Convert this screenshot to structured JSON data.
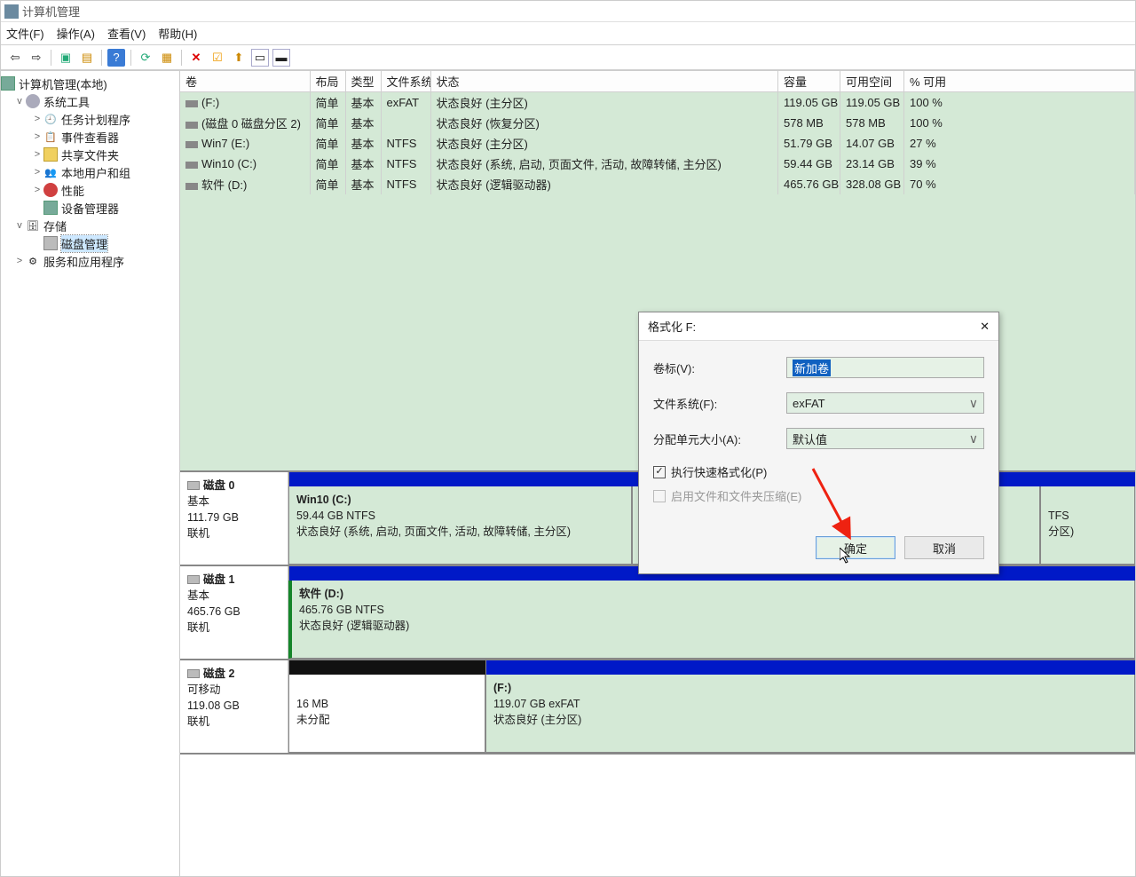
{
  "app": {
    "title": "计算机管理"
  },
  "menu": {
    "file": "文件(F)",
    "action": "操作(A)",
    "view": "查看(V)",
    "help": "帮助(H)"
  },
  "sidebar": {
    "root": "计算机管理(本地)",
    "sys_tools": "系统工具",
    "task_sched": "任务计划程序",
    "event_viewer": "事件查看器",
    "shared": "共享文件夹",
    "local_users": "本地用户和组",
    "perf": "性能",
    "dev_mgr": "设备管理器",
    "storage": "存储",
    "disk_mgmt": "磁盘管理",
    "services": "服务和应用程序"
  },
  "vol_headers": {
    "vol": "卷",
    "layout": "布局",
    "type": "类型",
    "fs": "文件系统",
    "status": "状态",
    "capacity": "容量",
    "free": "可用空间",
    "pct": "% 可用"
  },
  "volumes": [
    {
      "vol": "(F:)",
      "layout": "简单",
      "type": "基本",
      "fs": "exFAT",
      "status": "状态良好 (主分区)",
      "capacity": "119.05 GB",
      "free": "119.05 GB",
      "pct": "100 %"
    },
    {
      "vol": "(磁盘 0 磁盘分区 2)",
      "layout": "简单",
      "type": "基本",
      "fs": "",
      "status": "状态良好 (恢复分区)",
      "capacity": "578 MB",
      "free": "578 MB",
      "pct": "100 %"
    },
    {
      "vol": "Win7 (E:)",
      "layout": "简单",
      "type": "基本",
      "fs": "NTFS",
      "status": "状态良好 (主分区)",
      "capacity": "51.79 GB",
      "free": "14.07 GB",
      "pct": "27 %"
    },
    {
      "vol": "Win10 (C:)",
      "layout": "简单",
      "type": "基本",
      "fs": "NTFS",
      "status": "状态良好 (系统, 启动, 页面文件, 活动, 故障转储, 主分区)",
      "capacity": "59.44 GB",
      "free": "23.14 GB",
      "pct": "39 %"
    },
    {
      "vol": "软件 (D:)",
      "layout": "简单",
      "type": "基本",
      "fs": "NTFS",
      "status": "状态良好 (逻辑驱动器)",
      "capacity": "465.76 GB",
      "free": "328.08 GB",
      "pct": "70 %"
    }
  ],
  "disks": {
    "d0": {
      "hdr": "磁盘 0",
      "type": "基本",
      "size": "111.79 GB",
      "state": "联机",
      "p0": {
        "name": "Win10  (C:)",
        "detail": "59.44 GB NTFS",
        "status": "状态良好 (系统, 启动, 页面文件, 活动, 故障转储, 主分区)"
      },
      "p1": {
        "name": "TFS",
        "status": "分区)"
      }
    },
    "d1": {
      "hdr": "磁盘 1",
      "type": "基本",
      "size": "465.76 GB",
      "state": "联机",
      "p0": {
        "name": "软件  (D:)",
        "detail": "465.76 GB NTFS",
        "status": "状态良好 (逻辑驱动器)"
      }
    },
    "d2": {
      "hdr": "磁盘 2",
      "type": "可移动",
      "size": "119.08 GB",
      "state": "联机",
      "p0": {
        "detail": "16 MB",
        "status": "未分配"
      },
      "p1": {
        "name": "(F:)",
        "detail": "119.07 GB exFAT",
        "status": "状态良好 (主分区)"
      }
    }
  },
  "dialog": {
    "title": "格式化 F:",
    "close": "✕",
    "label_vol": "卷标(V):",
    "val_vol": "新加卷",
    "label_fs": "文件系统(F):",
    "val_fs": "exFAT",
    "label_au": "分配单元大小(A):",
    "val_au": "默认值",
    "chk_quick": "执行快速格式化(P)",
    "chk_compress": "启用文件和文件夹压缩(E)",
    "btn_ok": "确定",
    "btn_cancel": "取消"
  }
}
